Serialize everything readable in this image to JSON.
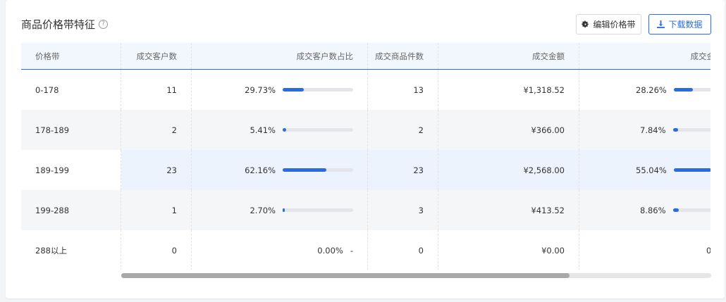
{
  "card": {
    "title": "商品价格带特征",
    "help_glyph": "?",
    "edit_button": "编辑价格带",
    "download_button": "下载数据"
  },
  "table": {
    "columns": [
      "价格带",
      "成交客户数",
      "成交客户数占比",
      "成交商品件数",
      "成交金额",
      "成交金"
    ],
    "rows": [
      {
        "band": "0-178",
        "customers": "11",
        "customer_pct": "29.73%",
        "customer_pct_value": 29.73,
        "items": "13",
        "amount": "¥1,318.52",
        "amount_pct": "28.26%",
        "amount_pct_value": 28.26
      },
      {
        "band": "178-189",
        "customers": "2",
        "customer_pct": "5.41%",
        "customer_pct_value": 5.41,
        "items": "2",
        "amount": "¥366.00",
        "amount_pct": "7.84%",
        "amount_pct_value": 7.84
      },
      {
        "band": "189-199",
        "customers": "23",
        "customer_pct": "62.16%",
        "customer_pct_value": 62.16,
        "items": "23",
        "amount": "¥2,568.00",
        "amount_pct": "55.04%",
        "amount_pct_value": 55.04
      },
      {
        "band": "199-288",
        "customers": "1",
        "customer_pct": "2.70%",
        "customer_pct_value": 2.7,
        "items": "3",
        "amount": "¥413.52",
        "amount_pct": "8.86%",
        "amount_pct_value": 8.86
      },
      {
        "band": "288以上",
        "customers": "0",
        "customer_pct": "0.00%",
        "customer_pct_value": 0,
        "customer_pct_dash": "-",
        "items": "0",
        "amount": "¥0.00",
        "amount_pct": "0",
        "amount_pct_value": 0
      }
    ]
  },
  "scrollbar": {
    "position_fraction": 0.0,
    "visible_fraction": 0.76
  },
  "colors": {
    "accent": "#2b6be0",
    "bar_track": "#e3e5e8",
    "row_alt": "#f5f6f8",
    "header_bg": "#f2f6fd"
  }
}
